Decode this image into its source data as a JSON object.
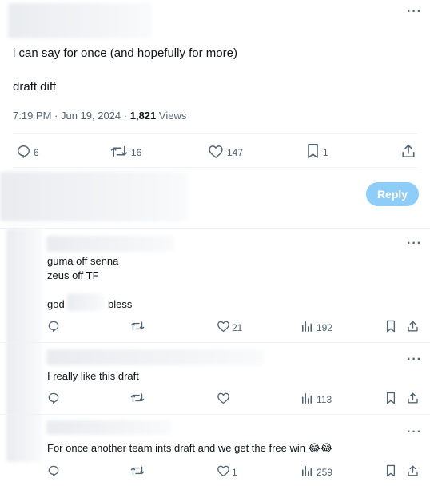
{
  "main_tweet": {
    "text_line1": "i can say for once (and hopefully for more)",
    "text_line2": "draft diff",
    "time": "7:19 PM",
    "sep1": " · ",
    "date": "Jun 19, 2024",
    "sep2": " · ",
    "views_count": "1,821",
    "views_label": " Views",
    "replies": "6",
    "reposts": "16",
    "likes": "147",
    "bookmarks": "1"
  },
  "reply_box": {
    "button_label": "Reply"
  },
  "replies": [
    {
      "line1": "guma off senna",
      "line2": "zeus off TF",
      "line3a": "god",
      "line3b": "bless",
      "likes": "21",
      "views": "192"
    },
    {
      "line1": "I really like this draft",
      "likes": "",
      "views": "113"
    },
    {
      "line1": "For once another team ints draft and we get the free win 😂😂",
      "likes": "1",
      "views": "259"
    }
  ],
  "colors": {
    "accent": "#1d9bf0",
    "reply_button_disabled": "#8ecdf8",
    "muted": "#536471"
  },
  "icons": [
    "more-icon",
    "reply-icon",
    "repost-icon",
    "like-icon",
    "bookmark-icon",
    "share-icon",
    "views-icon"
  ]
}
